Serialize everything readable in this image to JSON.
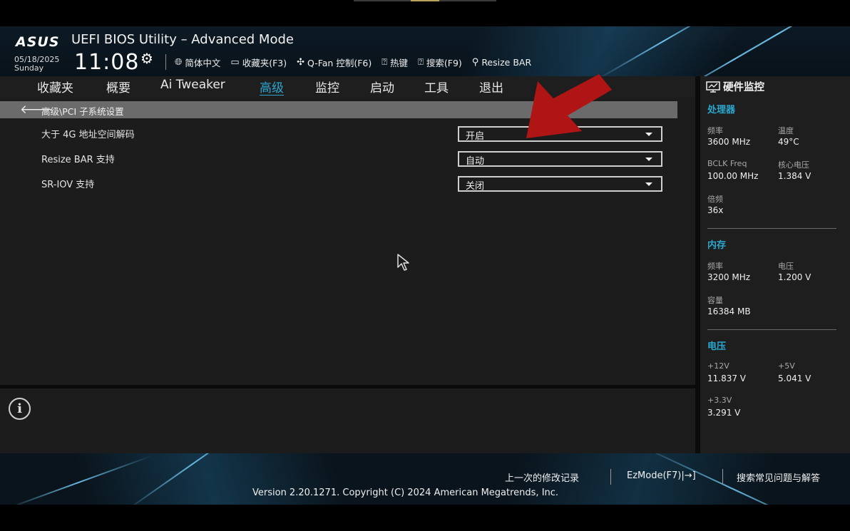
{
  "header": {
    "logo": "ASUS",
    "title": "UEFI BIOS Utility – Advanced Mode",
    "date": "05/18/2025",
    "day": "Sunday",
    "time": "11:08",
    "toolbar": [
      {
        "icon": "globe-icon",
        "label": "简体中文"
      },
      {
        "icon": "favorites-icon",
        "label": "收藏夹(F3)"
      },
      {
        "icon": "fan-icon",
        "label": "Q-Fan 控制(F6)"
      },
      {
        "icon": "help-icon",
        "label": "热键"
      },
      {
        "icon": "help-icon",
        "label": "搜索(F9)"
      },
      {
        "icon": "resize-bar-icon",
        "label": "Resize BAR"
      }
    ]
  },
  "tabs": [
    "收藏夹",
    "概要",
    "Ai Tweaker",
    "高级",
    "监控",
    "启动",
    "工具",
    "退出"
  ],
  "active_tab": "高级",
  "breadcrumb": "高级\\PCI 子系统设置",
  "settings": [
    {
      "label": "大于 4G 地址空间解码",
      "value": "开启"
    },
    {
      "label": "Resize BAR 支持",
      "value": "自动"
    },
    {
      "label": "SR-IOV 支持",
      "value": "关闭"
    }
  ],
  "hardware_monitor": {
    "title": "硬件监控",
    "cpu": {
      "heading": "处理器",
      "freq_label": "频率",
      "freq": "3600 MHz",
      "temp_label": "温度",
      "temp": "49°C",
      "bclk_label": "BCLK Freq",
      "bclk": "100.00 MHz",
      "vcore_label": "核心电压",
      "vcore": "1.384 V",
      "ratio_label": "倍频",
      "ratio": "36x"
    },
    "memory": {
      "heading": "内存",
      "freq_label": "频率",
      "freq": "3200 MHz",
      "volt_label": "电压",
      "volt": "1.200 V",
      "capacity_label": "容量",
      "capacity": "16384 MB"
    },
    "voltage": {
      "heading": "电压",
      "v12_label": "+12V",
      "v12": "11.837 V",
      "v5_label": "+5V",
      "v5": "5.041 V",
      "v33_label": "+3.3V",
      "v33": "3.291 V"
    }
  },
  "footer": {
    "last_changes": "上一次的修改记录",
    "ezmode": "EzMode(F7)|",
    "faq": "搜索常见问题与解答",
    "version": "Version 2.20.1271. Copyright (C) 2024 American Megatrends, Inc."
  },
  "colors": {
    "accent": "#2aa8d0",
    "annotation_arrow": "#b01515"
  }
}
